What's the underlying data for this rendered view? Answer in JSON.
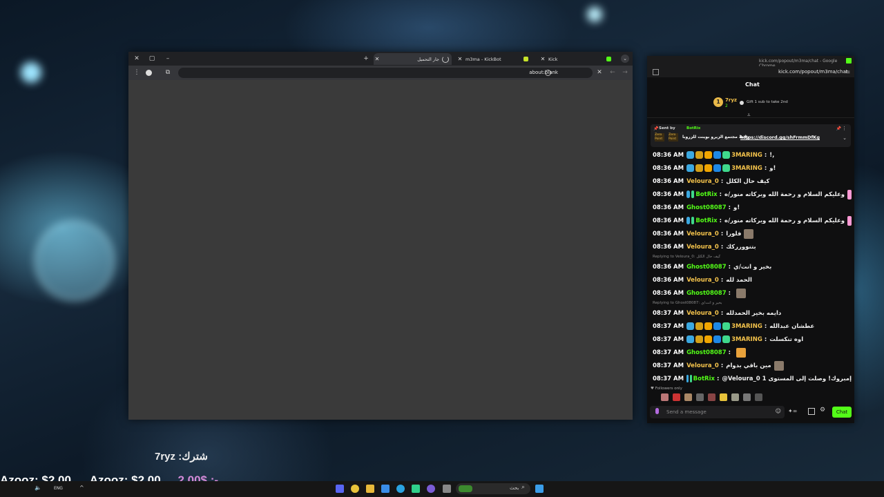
{
  "browser": {
    "tabs": [
      {
        "title": "جار التحميل",
        "state": "loading"
      },
      {
        "title": "m3ma - KickBot"
      },
      {
        "title": "Kick"
      }
    ],
    "new_tab_label": "+",
    "url": "about:blank"
  },
  "chat_window": {
    "window_title": "kick.com/popout/m3ma/chat - Google Chrome",
    "url": "kick.com/popout/m3ma/chat",
    "header_title": "Chat",
    "gifter": {
      "rank": "1",
      "name": "7ryz",
      "count": "2",
      "gift_text": "Gift 1 sub to take 2nd"
    },
    "pinned": {
      "sent_by_label": "Sent by",
      "sender": "BotRix",
      "badge_text": "Zero Point",
      "message": "رابط مجتمع الزيرو بوينت للزروبا",
      "link": "https://discord.gg/shFrmmDfKg"
    },
    "messages": [
      {
        "time": "08:36 AM",
        "user": "3MARING",
        "text": "!,",
        "badges": [
          "#3ba8e0",
          "#d4a017",
          "#f0a500",
          "#1e88e5",
          "#3fd88c"
        ],
        "color": "#f3c24b"
      },
      {
        "time": "08:36 AM",
        "user": "3MARING",
        "text": "و!",
        "badges": [
          "#3ba8e0",
          "#d4a017",
          "#f0a500",
          "#1e88e5",
          "#3fd88c"
        ],
        "color": "#f3c24b"
      },
      {
        "time": "08:36 AM",
        "user": "Veloura_0",
        "text": "كيف حال الكلل",
        "badges": [],
        "color": "#f3c24b"
      },
      {
        "time": "08:36 AM",
        "user": "BotRix",
        "text": "وعليكم السلام و رحمة الله وبركاته منور/ه",
        "badges": [
          "#3ba8e0",
          "#3fd88c"
        ],
        "color": "#53fc18",
        "emote": "heart"
      },
      {
        "time": "08:36 AM",
        "user": "Ghost08087",
        "text": "و!",
        "badges": [],
        "color": "#53fc18"
      },
      {
        "time": "08:36 AM",
        "user": "BotRix",
        "text": "وعليكم السلام و رحمة الله وبركاته منور/ه",
        "badges": [
          "#3ba8e0",
          "#3fd88c"
        ],
        "color": "#53fc18",
        "emote": "heart"
      },
      {
        "time": "08:36 AM",
        "user": "Veloura_0",
        "text": "فلورا",
        "badges": [],
        "color": "#f3c24b",
        "emote": "face"
      },
      {
        "time": "08:36 AM",
        "user": "Veloura_0",
        "text": "بتنوورركك",
        "badges": [],
        "color": "#f3c24b"
      },
      {
        "reply": "Replying to Veloura_0: كيف حال الكلل"
      },
      {
        "time": "08:36 AM",
        "user": "Ghost08087",
        "text": "بخير و انت/ي",
        "badges": [],
        "color": "#53fc18"
      },
      {
        "time": "08:36 AM",
        "user": "Veloura_0",
        "text": "الحمد لله",
        "badges": [],
        "color": "#f3c24b"
      },
      {
        "time": "08:36 AM",
        "user": "Ghost08087",
        "text": "",
        "badges": [],
        "color": "#53fc18",
        "emote": "face"
      },
      {
        "reply": "Replying to Ghost08087: بخير و انت/ي"
      },
      {
        "time": "08:37 AM",
        "user": "Veloura_0",
        "text": "دايمه بخير الحمدلله",
        "badges": [],
        "color": "#f3c24b"
      },
      {
        "time": "08:37 AM",
        "user": "3MARING",
        "text": "عطشان عبدالله",
        "badges": [
          "#3ba8e0",
          "#d4a017",
          "#f0a500",
          "#1e88e5",
          "#3fd88c"
        ],
        "color": "#f3c24b"
      },
      {
        "time": "08:37 AM",
        "user": "3MARING",
        "text": "اوه تنكسلت",
        "badges": [
          "#3ba8e0",
          "#d4a017",
          "#f0a500",
          "#1e88e5",
          "#3fd88c"
        ],
        "color": "#f3c24b"
      },
      {
        "time": "08:37 AM",
        "user": "Ghost08087",
        "text": "",
        "badges": [],
        "color": "#53fc18",
        "emote": "duck"
      },
      {
        "time": "08:37 AM",
        "user": "Veloura_0",
        "text": "مين باقي بدوام",
        "badges": [],
        "color": "#f3c24b",
        "emote": "face"
      },
      {
        "time": "08:37 AM",
        "user": "BotRix",
        "text": "@Veloura_0 إمبروك! وصلت إلى المستوى 1",
        "badges": [
          "#3ba8e0",
          "#3fd88c"
        ],
        "color": "#53fc18"
      }
    ],
    "followers_only": "Followers only",
    "input_placeholder": "Send a message",
    "send_label": "Chat"
  },
  "overlay": {
    "sub_alert": "7ryz :شترك",
    "donations": [
      "Azooz: $2.00",
      "Azooz: $2.00",
      "2.00$ :-"
    ]
  },
  "taskbar": {
    "language": "ENG",
    "search_label": "بحث"
  },
  "colors": {
    "kick_green": "#53fc18",
    "chat_bg": "#0f0f10",
    "browser_bg": "#3a3a3a"
  }
}
